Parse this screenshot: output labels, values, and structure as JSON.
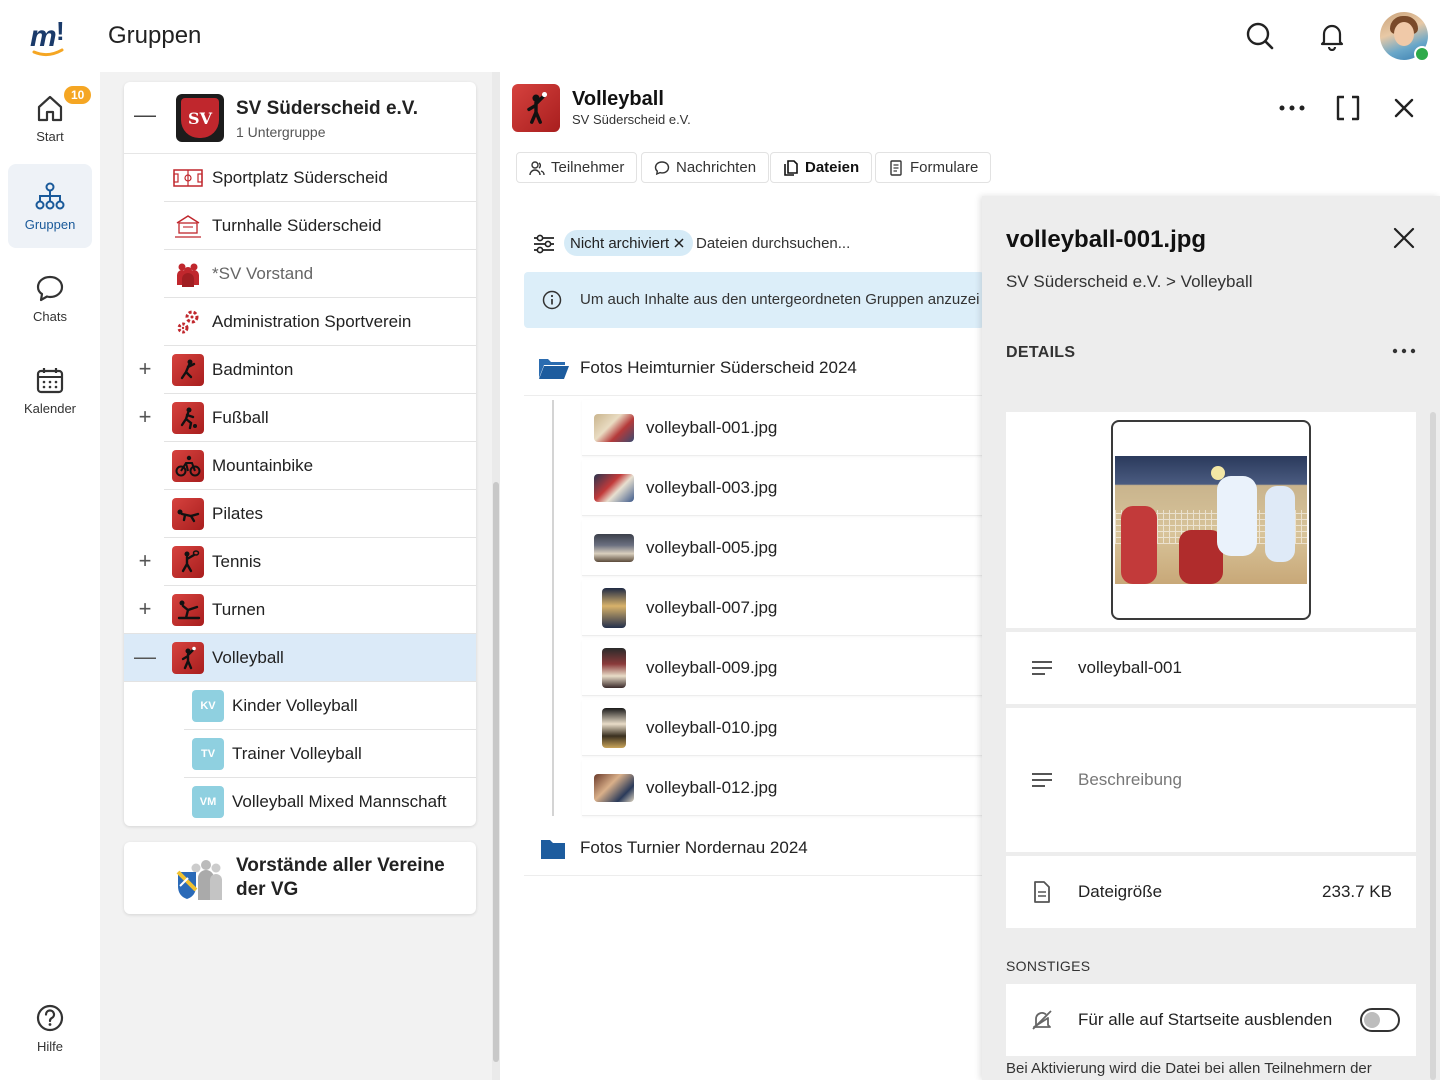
{
  "app": {
    "title": "Gruppen"
  },
  "nav": {
    "start_label": "Start",
    "start_badge": "10",
    "groups_label": "Gruppen",
    "chats_label": "Chats",
    "calendar_label": "Kalender",
    "help_label": "Hilfe"
  },
  "club": {
    "name": "SV Süderscheid e.V.",
    "subtitle": "1 Untergruppe",
    "logo_text": "SV",
    "groups": [
      {
        "label": "Sportplatz Süderscheid",
        "toggle": ""
      },
      {
        "label": "Turnhalle Süderscheid",
        "toggle": ""
      },
      {
        "label": "*SV Vorstand",
        "toggle": ""
      },
      {
        "label": "Administration Sportverein",
        "toggle": ""
      },
      {
        "label": "Badminton",
        "toggle": "+"
      },
      {
        "label": "Fußball",
        "toggle": "+"
      },
      {
        "label": "Mountainbike",
        "toggle": ""
      },
      {
        "label": "Pilates",
        "toggle": ""
      },
      {
        "label": "Tennis",
        "toggle": "+"
      },
      {
        "label": "Turnen",
        "toggle": "+"
      },
      {
        "label": "Volleyball",
        "toggle": "—"
      }
    ],
    "subgroups": [
      {
        "label": "Kinder Volleyball",
        "initials": "KV"
      },
      {
        "label": "Trainer Volleyball",
        "initials": "TV"
      },
      {
        "label": "Volleyball Mixed Mannschaft",
        "initials": "VM"
      }
    ],
    "collapse_toggle": "—"
  },
  "vg": {
    "name": "Vorstände aller Vereine der VG"
  },
  "group_view": {
    "title": "Volleyball",
    "subtitle": "SV Süderscheid e.V.",
    "tabs": [
      {
        "label": "Teilnehmer"
      },
      {
        "label": "Nachrichten"
      },
      {
        "label": "Dateien"
      },
      {
        "label": "Formulare"
      }
    ],
    "filter_chip": "Nicht archiviert",
    "search_placeholder": "Dateien durchsuchen...",
    "info_text": "Um auch Inhalte aus den untergeordneten Gruppen anzuzeigen",
    "folders": [
      {
        "label": "Fotos Heimturnier Süderscheid 2024"
      },
      {
        "label": "Fotos Turnier Nordernau 2024"
      }
    ],
    "files": [
      {
        "name": "volleyball-001.jpg"
      },
      {
        "name": "volleyball-003.jpg"
      },
      {
        "name": "volleyball-005.jpg"
      },
      {
        "name": "volleyball-007.jpg"
      },
      {
        "name": "volleyball-009.jpg"
      },
      {
        "name": "volleyball-010.jpg"
      },
      {
        "name": "volleyball-012.jpg"
      }
    ]
  },
  "details": {
    "title": "volleyball-001.jpg",
    "path": "SV Süderscheid e.V. > Volleyball",
    "section_details": "DETAILS",
    "name_value": "volleyball-001",
    "description_placeholder": "Beschreibung",
    "size_label": "Dateigröße",
    "size_value": "233.7 KB",
    "section_other": "SONSTIGES",
    "hide_label": "Für alle auf Startseite ausblenden",
    "hide_enabled": false,
    "note": "Bei Aktivierung wird die Datei bei allen Teilnehmern der"
  },
  "colors": {
    "accent": "#1a5a9a",
    "selected_row": "#dbeaf8",
    "info_bg": "#dceef9",
    "badge": "#f5a623",
    "brand_red": "#c0272d"
  }
}
